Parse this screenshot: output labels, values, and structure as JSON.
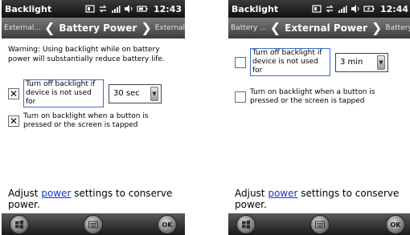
{
  "left": {
    "status": {
      "title": "Backlight",
      "time": "12:43"
    },
    "nav": {
      "prev": "External...",
      "current": "Battery Power",
      "next": "External..."
    },
    "warning": "Warning: Using backlight while on battery power will substantially reduce battery life.",
    "option1": {
      "label": "Turn off backlight if device is not used for",
      "checked": "✕",
      "value": "30 sec"
    },
    "option2": {
      "label": "Turn on backlight when a button is pressed or the screen is tapped",
      "checked": "✕"
    },
    "footer": {
      "before": "Adjust ",
      "link": "power",
      "after": " settings to conserve power."
    },
    "softkeys": {
      "ok": "OK"
    }
  },
  "right": {
    "status": {
      "title": "Backlight",
      "time": "12:44"
    },
    "nav": {
      "prev": "Battery ...",
      "current": "External Power",
      "next": "Battery ..."
    },
    "option1": {
      "label": "Turn off backlight if device is not used for",
      "checked": "",
      "value": "3 min"
    },
    "option2": {
      "label": "Turn on backlight when a button is pressed or the screen is tapped",
      "checked": ""
    },
    "footer": {
      "before": "Adjust ",
      "link": "power",
      "after": " settings to conserve power."
    },
    "softkeys": {
      "ok": "OK"
    }
  },
  "colors": {
    "link": "#1a33cc",
    "focus_border": "#3a6fd0"
  }
}
